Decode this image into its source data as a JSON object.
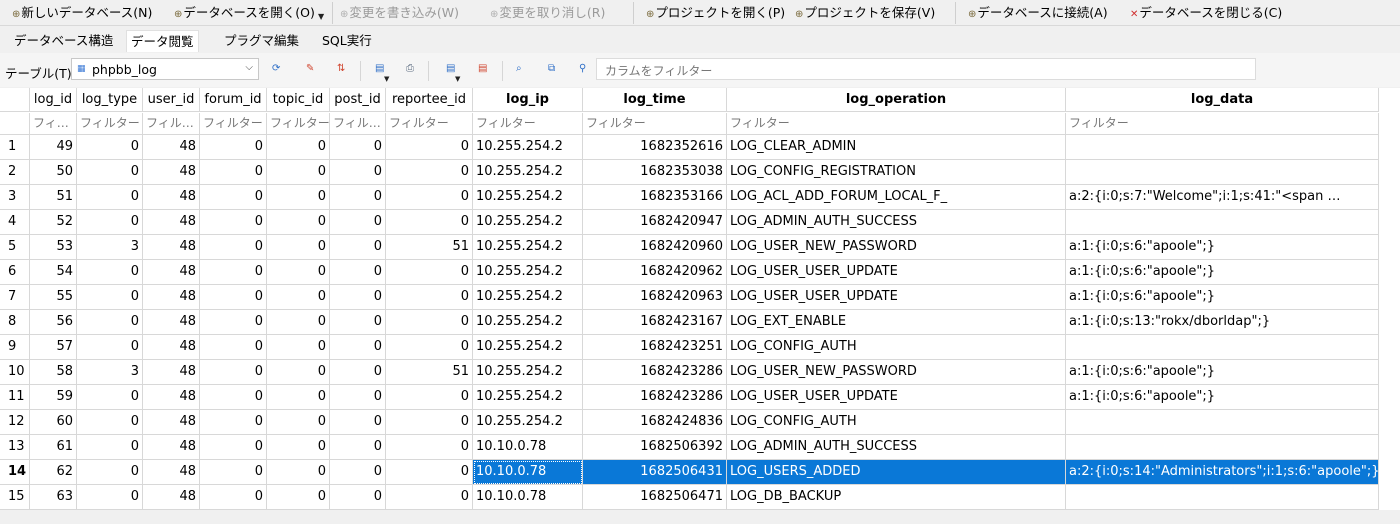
{
  "toolbar": {
    "new_db": "新しいデータベース(N)",
    "open_db": "データベースを開く(O)",
    "write_changes": "変更を書き込み(W)",
    "revert_changes": "変更を取り消し(R)",
    "open_project": "プロジェクトを開く(P)",
    "save_project": "プロジェクトを保存(V)",
    "attach_db": "データベースに接続(A)",
    "close_db": "データベースを閉じる(C)"
  },
  "tabs": [
    "データベース構造",
    "データ閲覧",
    "プラグマ編集",
    "SQL実行"
  ],
  "active_tab": 1,
  "table_toolbar": {
    "table_label": "テーブル(T):",
    "table_value": "phpbb_log",
    "column_filter_placeholder": "カラムをフィルター"
  },
  "grid": {
    "filter_placeholder": "フィルター",
    "filter_truncated_3": "フィ…",
    "filter_truncated_6": "フィル…",
    "columns": [
      "log_id",
      "log_type",
      "user_id",
      "forum_id",
      "topic_id",
      "post_id",
      "reportee_id",
      "log_ip",
      "log_time",
      "log_operation",
      "log_data"
    ],
    "selected_row_index": 13,
    "rows": [
      {
        "n": "1",
        "c": [
          "49",
          "0",
          "48",
          "0",
          "0",
          "0",
          "0",
          "10.255.254.2",
          "1682352616",
          "LOG_CLEAR_ADMIN",
          ""
        ]
      },
      {
        "n": "2",
        "c": [
          "50",
          "0",
          "48",
          "0",
          "0",
          "0",
          "0",
          "10.255.254.2",
          "1682353038",
          "LOG_CONFIG_REGISTRATION",
          ""
        ]
      },
      {
        "n": "3",
        "c": [
          "51",
          "0",
          "48",
          "0",
          "0",
          "0",
          "0",
          "10.255.254.2",
          "1682353166",
          "LOG_ACL_ADD_FORUM_LOCAL_F_",
          "a:2:{i:0;s:7:\"Welcome\";i:1;s:41:\"<span …"
        ]
      },
      {
        "n": "4",
        "c": [
          "52",
          "0",
          "48",
          "0",
          "0",
          "0",
          "0",
          "10.255.254.2",
          "1682420947",
          "LOG_ADMIN_AUTH_SUCCESS",
          ""
        ]
      },
      {
        "n": "5",
        "c": [
          "53",
          "3",
          "48",
          "0",
          "0",
          "0",
          "51",
          "10.255.254.2",
          "1682420960",
          "LOG_USER_NEW_PASSWORD",
          "a:1:{i:0;s:6:\"apoole\";}"
        ]
      },
      {
        "n": "6",
        "c": [
          "54",
          "0",
          "48",
          "0",
          "0",
          "0",
          "0",
          "10.255.254.2",
          "1682420962",
          "LOG_USER_USER_UPDATE",
          "a:1:{i:0;s:6:\"apoole\";}"
        ]
      },
      {
        "n": "7",
        "c": [
          "55",
          "0",
          "48",
          "0",
          "0",
          "0",
          "0",
          "10.255.254.2",
          "1682420963",
          "LOG_USER_USER_UPDATE",
          "a:1:{i:0;s:6:\"apoole\";}"
        ]
      },
      {
        "n": "8",
        "c": [
          "56",
          "0",
          "48",
          "0",
          "0",
          "0",
          "0",
          "10.255.254.2",
          "1682423167",
          "LOG_EXT_ENABLE",
          "a:1:{i:0;s:13:\"rokx/dborldap\";}"
        ]
      },
      {
        "n": "9",
        "c": [
          "57",
          "0",
          "48",
          "0",
          "0",
          "0",
          "0",
          "10.255.254.2",
          "1682423251",
          "LOG_CONFIG_AUTH",
          ""
        ]
      },
      {
        "n": "10",
        "c": [
          "58",
          "3",
          "48",
          "0",
          "0",
          "0",
          "51",
          "10.255.254.2",
          "1682423286",
          "LOG_USER_NEW_PASSWORD",
          "a:1:{i:0;s:6:\"apoole\";}"
        ]
      },
      {
        "n": "11",
        "c": [
          "59",
          "0",
          "48",
          "0",
          "0",
          "0",
          "0",
          "10.255.254.2",
          "1682423286",
          "LOG_USER_USER_UPDATE",
          "a:1:{i:0;s:6:\"apoole\";}"
        ]
      },
      {
        "n": "12",
        "c": [
          "60",
          "0",
          "48",
          "0",
          "0",
          "0",
          "0",
          "10.255.254.2",
          "1682424836",
          "LOG_CONFIG_AUTH",
          ""
        ]
      },
      {
        "n": "13",
        "c": [
          "61",
          "0",
          "48",
          "0",
          "0",
          "0",
          "0",
          "10.10.0.78",
          "1682506392",
          "LOG_ADMIN_AUTH_SUCCESS",
          ""
        ]
      },
      {
        "n": "14",
        "c": [
          "62",
          "0",
          "48",
          "0",
          "0",
          "0",
          "0",
          "10.10.0.78",
          "1682506431",
          "LOG_USERS_ADDED",
          "a:2:{i:0;s:14:\"Administrators\";i:1;s:6:\"apoole\";}"
        ]
      },
      {
        "n": "15",
        "c": [
          "63",
          "0",
          "48",
          "0",
          "0",
          "0",
          "0",
          "10.10.0.78",
          "1682506471",
          "LOG_DB_BACKUP",
          ""
        ]
      }
    ]
  }
}
